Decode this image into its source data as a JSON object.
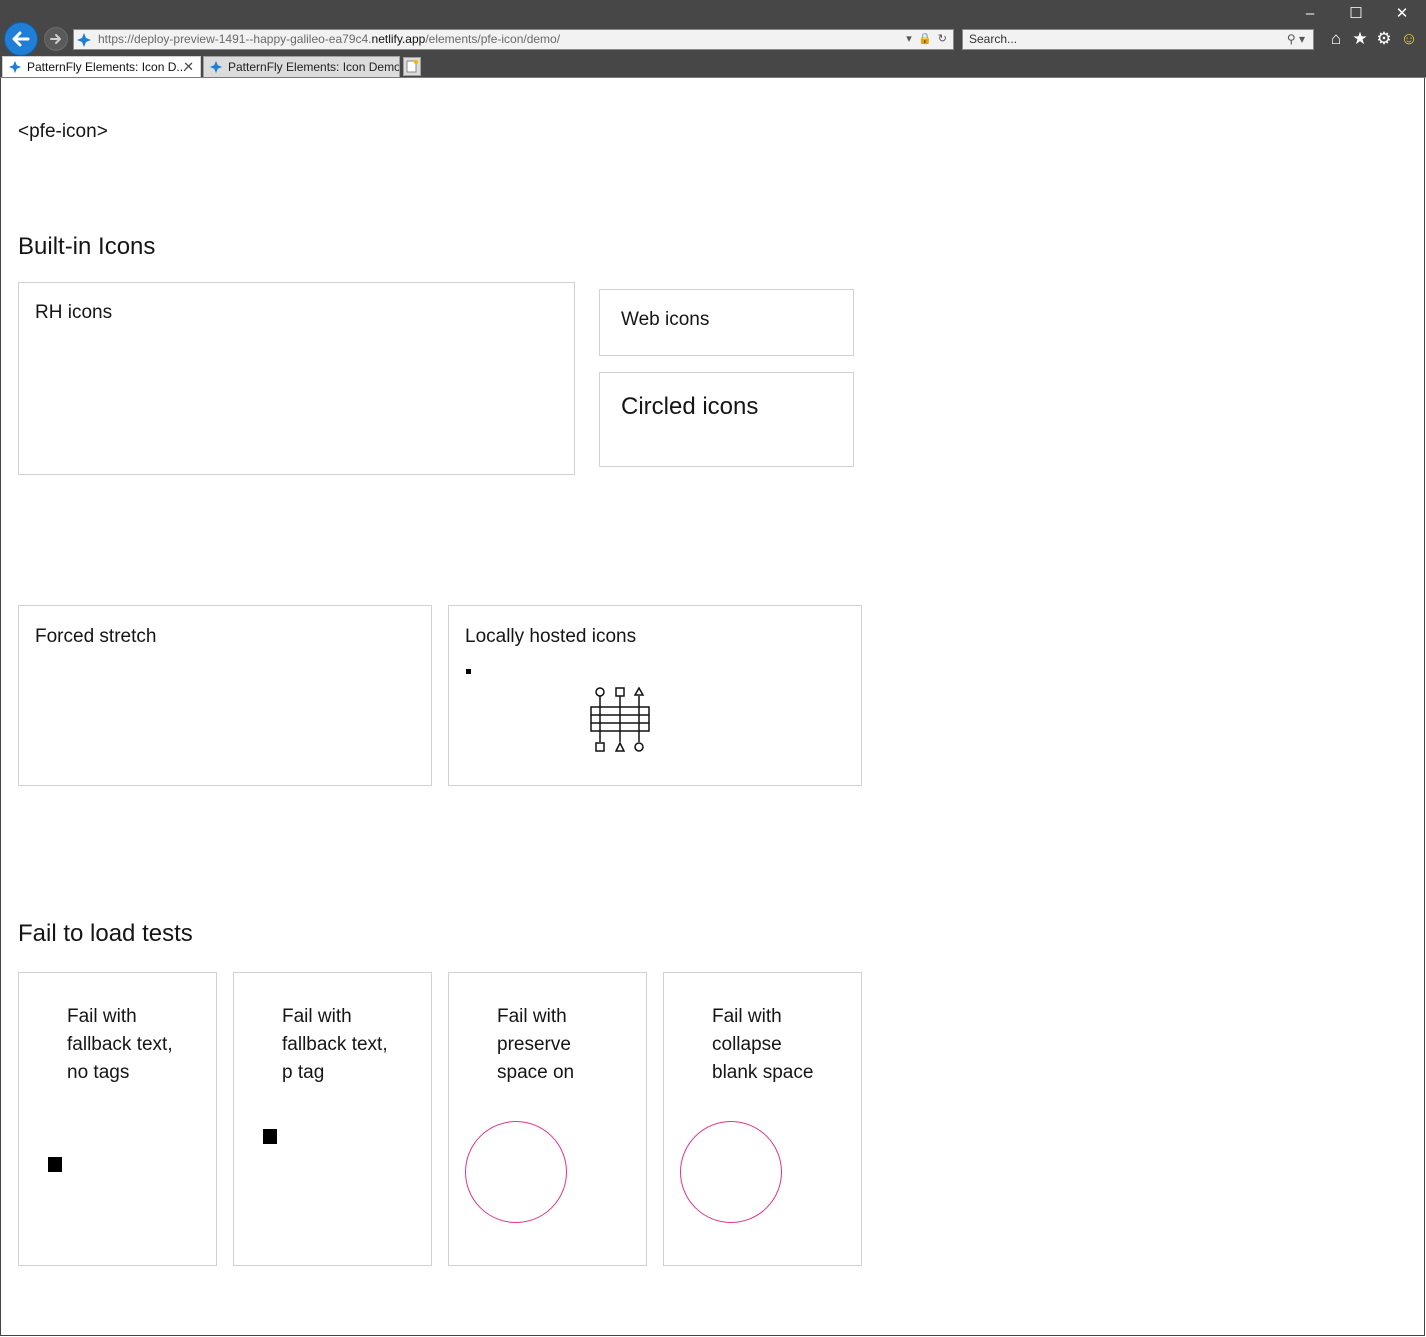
{
  "browser": {
    "url_scheme": "https://",
    "url_pre": "deploy-preview-1491--happy-galileo-ea79c4.",
    "url_host": "netlify.app",
    "url_path": "/elements/pfe-icon/demo/",
    "search_placeholder": "Search...",
    "tabs": [
      {
        "label": "PatternFly Elements: Icon D...",
        "active": true
      },
      {
        "label": "PatternFly Elements: Icon Demo",
        "active": false
      }
    ],
    "close_glyph": "✕",
    "accent_color": "#1f7ed6"
  },
  "page": {
    "title": "<pfe-icon>",
    "builtin": {
      "heading": "Built-in Icons",
      "rh_icons": "RH icons",
      "web_icons": "Web icons",
      "circled_icons": "Circled icons"
    },
    "forced_stretch": "Forced stretch",
    "locally_hosted": "Locally hosted icons",
    "fail": {
      "heading": "Fail to load tests",
      "cards": [
        {
          "text": "Fail with fallback text, no tags"
        },
        {
          "text": "Fail with fallback text, p tag"
        },
        {
          "text": "Fail with preserve space on"
        },
        {
          "text": "Fail with collapse blank space"
        }
      ],
      "ring_color": "#e0348a"
    }
  }
}
